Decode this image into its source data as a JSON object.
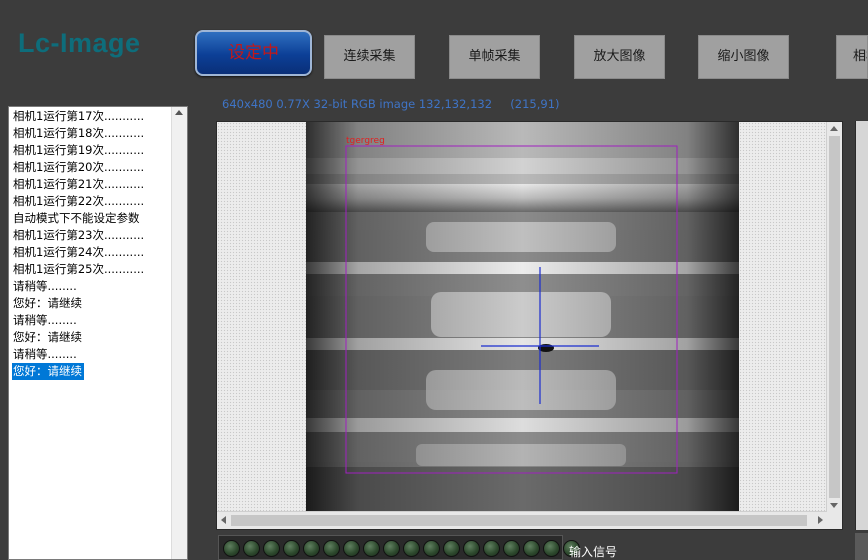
{
  "app": {
    "logo": "Lc-Image"
  },
  "toolbar": {
    "primary": "设定中",
    "buttons": [
      "连续采集",
      "单帧采集",
      "放大图像",
      "缩小图像",
      "相机"
    ]
  },
  "log": {
    "items": [
      "相机1运行第17次...........",
      "相机1运行第18次...........",
      "相机1运行第19次...........",
      "相机1运行第20次...........",
      "相机1运行第21次...........",
      "相机1运行第22次...........",
      "自动模式下不能设定参数",
      "相机1运行第23次...........",
      "相机1运行第24次...........",
      "相机1运行第25次...........",
      "请稍等........",
      "您好：请继续",
      "请稍等........",
      "您好：请继续",
      "请稍等........",
      "您好：请继续"
    ],
    "selected_index": 15
  },
  "viewer": {
    "status": "640x480 0.77X 32-bit RGB image 132,132,132     (215,91)",
    "roi_label": "tgergreg",
    "roi_color": "#a020c0",
    "crosshair_color": "#1a2ccf"
  },
  "io": {
    "label": "输入信号",
    "led_count": 18
  },
  "colors": {
    "accent": "#0c3f96",
    "primary_text": "#c41818",
    "logo": "#0e6d7b",
    "status_text": "#3f74c6"
  }
}
